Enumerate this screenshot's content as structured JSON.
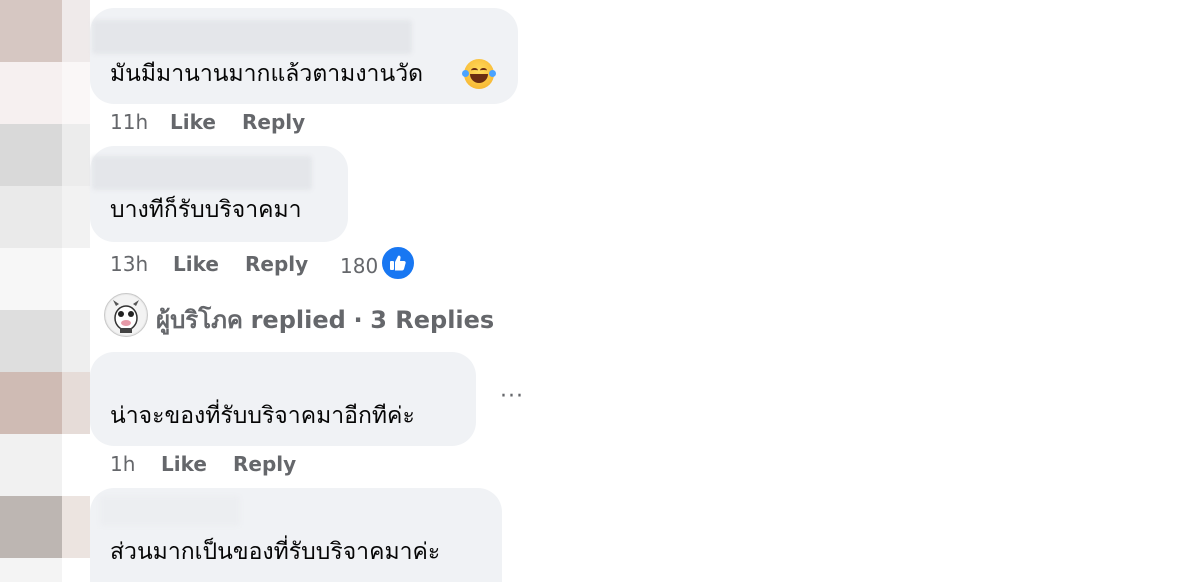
{
  "comments": [
    {
      "text": "มันมีมานานมากแล้วตามงานวัด",
      "emoji": "grinning-squinting-face-with-tears-emoji",
      "time": "11h",
      "like": "Like",
      "reply": "Reply"
    },
    {
      "text": "บางทีก็รับบริจาคมา",
      "time": "13h",
      "like": "Like",
      "reply": "Reply",
      "reaction_count": "180"
    },
    {
      "text": "น่าจะของที่รับบริจาคมาอีกทีค่ะ",
      "time": "1h",
      "like": "Like",
      "reply": "Reply",
      "more": "···"
    },
    {
      "text": "ส่วนมากเป็นของที่รับบริจาคมาค่ะ"
    }
  ],
  "replied": {
    "name": "ผู้บริโภค",
    "action": "replied",
    "separator": "·",
    "count_label": "3 Replies"
  },
  "colors": {
    "bubble": "#f0f2f5",
    "meta": "#65676b",
    "like_blue": "#1877f2"
  }
}
